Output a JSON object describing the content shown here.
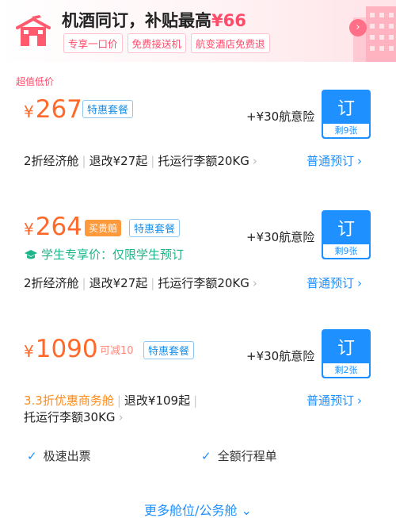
{
  "banner": {
    "title": "机酒同订，补贴最高",
    "amount": "¥66",
    "tags": [
      "专享一口价",
      "免费接送机",
      "航变酒店免费退"
    ]
  },
  "section_label": "超值低价",
  "offers": [
    {
      "currency": "¥",
      "price": "267",
      "tag_package": "特惠套餐",
      "insurance": "+¥30航意险",
      "book_label": "订",
      "remaining": "剩9张",
      "cabin": "2折经济舱",
      "change": "退改¥27起",
      "baggage": "托运行李额20KG",
      "normal_book": "普通预订"
    },
    {
      "currency": "¥",
      "price": "264",
      "tag_promo": "买贵赔",
      "tag_package": "特惠套餐",
      "student": "学生专享价：仅限学生预订",
      "insurance": "+¥30航意险",
      "book_label": "订",
      "remaining": "剩9张",
      "cabin": "2折经济舱",
      "change": "退改¥27起",
      "baggage": "托运行李额20KG",
      "normal_book": "普通预订"
    },
    {
      "currency": "¥",
      "price": "1090",
      "tag_discount": "可减10",
      "tag_package": "特惠套餐",
      "insurance": "+¥30航意险",
      "book_label": "订",
      "remaining": "剩2张",
      "cabin": "3.3折优惠商务舱",
      "change": "退改¥109起",
      "baggage": "托运行李额30KG",
      "normal_book": "普通预订"
    }
  ],
  "features": [
    "极速出票",
    "全额行程单"
  ],
  "more_label": "更多舱位/公务舱",
  "colors": {
    "accent_blue": "#1e90ff",
    "price_orange": "#ff6a2b",
    "promo_pink": "#ff4b6a",
    "student_green": "#1cb58a"
  }
}
